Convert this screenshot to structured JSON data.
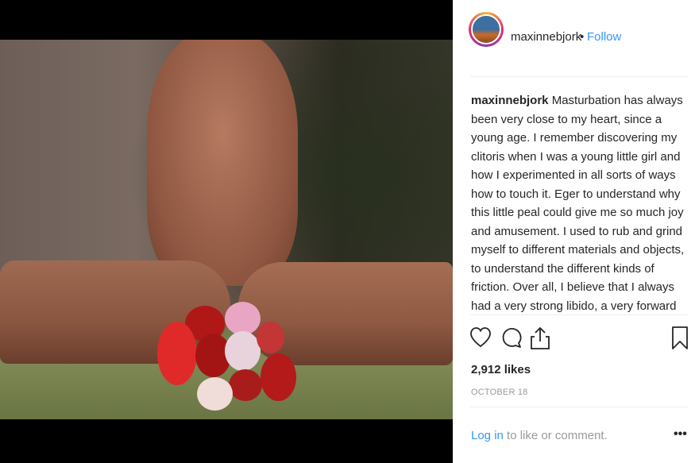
{
  "post": {
    "username": "maxinnebjork",
    "follow_label": "Follow",
    "separator": "•",
    "caption_username": "maxinnebjork",
    "caption_text": "Masturbation has always been very close to my heart, since a young age. I remember discovering my clitoris when I was a young little girl and how I experimented in all sorts of ways how to touch it. Eger to understand why this little peal could give me so much joy and amusement. I used to rub and grind myself to different materials and objects, to understand the different kinds of friction. Over all, I believe that I always had a very strong libido, a very forward going",
    "likes": "2,912 likes",
    "date": "OCTOBER 18",
    "login_link": "Log in",
    "login_suffix": " to like or comment.",
    "more_label": "•••"
  },
  "icons": {
    "like": "heart-icon",
    "comment": "comment-icon",
    "share": "share-icon",
    "save": "bookmark-icon",
    "more": "more-options-icon"
  },
  "colors": {
    "link": "#3897f0",
    "text": "#262626",
    "muted": "#999999"
  }
}
